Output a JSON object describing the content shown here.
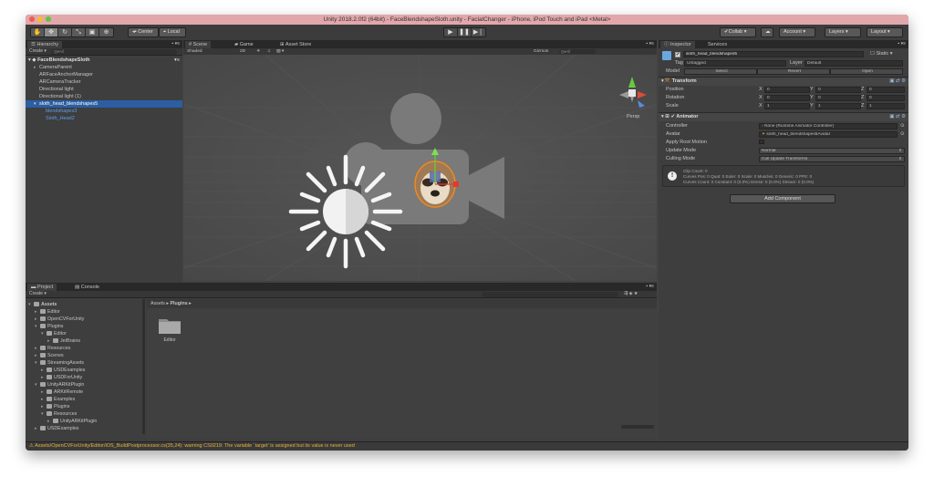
{
  "window": {
    "title": "Unity 2018.2.0f2 (64bit) - FaceBlendshapeSloth.unity - FacialChanger - iPhone, iPod Touch and iPad <Metal>"
  },
  "toolbar": {
    "center_label": "Center",
    "local_label": "Local",
    "collab_label": "Collab",
    "account_label": "Account",
    "layers_label": "Layers",
    "layout_label": "Layout",
    "play_icon": "play-icon",
    "pause_icon": "pause-icon",
    "step_icon": "step-icon"
  },
  "hierarchy": {
    "tab": "Hierarchy",
    "create": "Create",
    "search": "Q▾All",
    "scene": "FaceBlendshapeSloth",
    "items": [
      "CameraParent",
      "ARFaceAnchorManager",
      "ARCameraTracker",
      "Directional light",
      "Directional light (1)",
      "sloth_head_blendshapes5",
      "blendshapes3",
      "Sloth_Head2"
    ]
  },
  "scene": {
    "tabs": [
      "Scene",
      "Game",
      "Asset Store"
    ],
    "shading": "Shaded",
    "mode_2d": "2D",
    "gizmos": "Gizmos",
    "search": "Q▾All",
    "persp": "Persp"
  },
  "inspector": {
    "tabs": [
      "Inspector",
      "Services"
    ],
    "object_name": "sloth_head_blendshapes5",
    "static_label": "Static",
    "tag_label": "Tag",
    "tag_value": "Untagged",
    "layer_label": "Layer",
    "layer_value": "Default",
    "model_label": "Model",
    "model_buttons": [
      "Select",
      "Revert",
      "Open"
    ],
    "transform": {
      "title": "Transform",
      "rows": [
        {
          "label": "Position",
          "x": "0",
          "y": "0",
          "z": "0"
        },
        {
          "label": "Rotation",
          "x": "0",
          "y": "0",
          "z": "0"
        },
        {
          "label": "Scale",
          "x": "1",
          "y": "1",
          "z": "1"
        }
      ]
    },
    "animator": {
      "title": "Animator",
      "controller_label": "Controller",
      "controller_value": "None (Runtime Animator Controller)",
      "avatar_label": "Avatar",
      "avatar_value": "sloth_head_blendshapes5Avatar",
      "root_motion_label": "Apply Root Motion",
      "update_mode_label": "Update Mode",
      "update_mode_value": "Normal",
      "culling_label": "Culling Mode",
      "culling_value": "Cull Update Transforms",
      "info_lines": [
        "Clip Count: 0",
        "Curves Pos: 0 Quat: 0 Euler: 0 Scale: 0 Muscles: 0 Generic: 0 PPtr: 0",
        "Curves Count: 0 Constant: 0 (0.0%) Dense: 0 (0.0%) Stream: 0 (0.0%)"
      ]
    },
    "add_component": "Add Component"
  },
  "project": {
    "tabs": [
      "Project",
      "Console"
    ],
    "create": "Create",
    "breadcrumb": [
      "Assets",
      "Plugins"
    ],
    "tree": [
      {
        "label": "Assets",
        "depth": 0,
        "open": true
      },
      {
        "label": "Editor",
        "depth": 1,
        "open": false
      },
      {
        "label": "OpenCVForUnity",
        "depth": 1,
        "open": false
      },
      {
        "label": "Plugins",
        "depth": 1,
        "open": true
      },
      {
        "label": "Editor",
        "depth": 2,
        "open": true
      },
      {
        "label": "JetBrains",
        "depth": 3,
        "open": false
      },
      {
        "label": "Resources",
        "depth": 1,
        "open": false
      },
      {
        "label": "Scenes",
        "depth": 1,
        "open": false
      },
      {
        "label": "StreamingAssets",
        "depth": 1,
        "open": true
      },
      {
        "label": "USDExamples",
        "depth": 2,
        "open": false
      },
      {
        "label": "USDForUnity",
        "depth": 2,
        "open": false
      },
      {
        "label": "UnityARKitPlugin",
        "depth": 1,
        "open": true
      },
      {
        "label": "ARKitRemote",
        "depth": 2,
        "open": false
      },
      {
        "label": "Examples",
        "depth": 2,
        "open": false
      },
      {
        "label": "Plugins",
        "depth": 2,
        "open": false
      },
      {
        "label": "Resources",
        "depth": 2,
        "open": true
      },
      {
        "label": "UnityARKitPlugin",
        "depth": 3,
        "open": false
      },
      {
        "label": "USDExamples",
        "depth": 1,
        "open": false
      }
    ],
    "grid_item": "Editor"
  },
  "status": {
    "message": "Assets/OpenCVForUnity/Editor/iOS_BuildPostprocessor.cs(35,24): warning CS0219: The variable `target' is assigned but its value is never used"
  }
}
